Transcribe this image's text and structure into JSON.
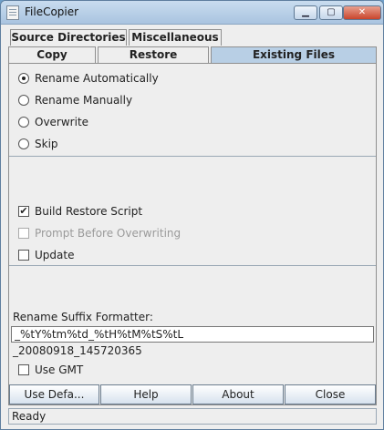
{
  "window": {
    "title": "FileCopier",
    "minimize": "▁",
    "maximize": "▢",
    "close": "✕"
  },
  "tabs": {
    "row1": [
      "Source Directories",
      "Miscellaneous"
    ],
    "row2": [
      "Copy",
      "Restore",
      "Existing Files"
    ],
    "selected": "Existing Files"
  },
  "existing_files": {
    "options": [
      {
        "label": "Rename Automatically",
        "selected": true
      },
      {
        "label": "Rename Manually",
        "selected": false
      },
      {
        "label": "Overwrite",
        "selected": false
      },
      {
        "label": "Skip",
        "selected": false
      }
    ],
    "checks": [
      {
        "label": "Build Restore Script",
        "checked": true,
        "enabled": true,
        "mark": "✔"
      },
      {
        "label": "Prompt Before Overwriting",
        "checked": false,
        "enabled": false,
        "mark": ""
      },
      {
        "label": "Update",
        "checked": false,
        "enabled": true,
        "mark": ""
      }
    ],
    "suffix_label": "Rename Suffix Formatter:",
    "suffix_value": "_%tY%tm%td_%tH%tM%tS%tL",
    "suffix_preview": "_20080918_145720365",
    "use_gmt": {
      "label": "Use GMT",
      "checked": false,
      "mark": ""
    }
  },
  "buttons": [
    "Use Defa...",
    "Help",
    "About",
    "Close"
  ],
  "status": "Ready"
}
